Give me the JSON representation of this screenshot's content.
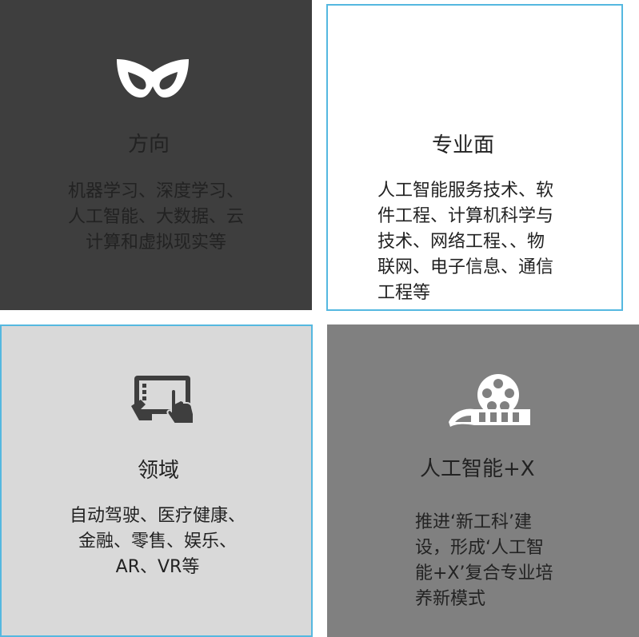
{
  "panels": [
    {
      "icon": "mask-icon",
      "title": "方向",
      "lines": [
        "机器学习、深度学习、",
        "人工智能、大数据、云",
        "计算和虚拟现实等"
      ]
    },
    {
      "title": "专业面",
      "lines": [
        "人工智能服务技术、软",
        "件工程、计算机科学与",
        "技术、网络工程、、物",
        "联网、电子信息、通信",
        "工程等"
      ]
    },
    {
      "icon": "tablet-touch-icon",
      "title": "领域",
      "lines": [
        "自动驾驶、医疗健康、",
        "金融、零售、娱乐、",
        "AR、VR等"
      ]
    },
    {
      "icon": "film-reel-icon",
      "title": "人工智能+X",
      "lines": [
        "推进‘新工科’建",
        "设，形成‘人工智",
        "能+X’复合专业培",
        "养新模式"
      ]
    }
  ]
}
